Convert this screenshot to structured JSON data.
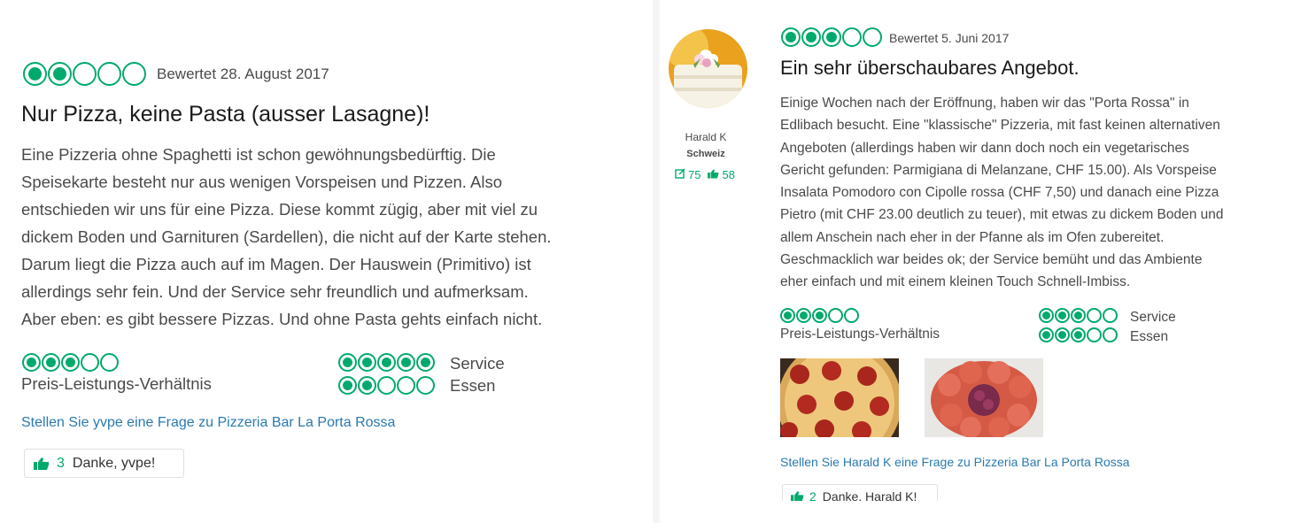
{
  "left_review": {
    "rating": 2,
    "date": "Bewertet 28. August 2017",
    "title": "Nur Pizza, keine Pasta (ausser Lasagne)!",
    "body": [
      "Eine Pizzeria ohne Spaghetti ist schon gewöhnungsbedürftig. Die",
      "Speisekarte besteht nur aus wenigen Vorspeisen und Pizzen. Also",
      "entschieden wir uns für eine Pizza. Diese kommt zügig, aber mit viel zu",
      "dickem Boden und Garnituren (Sardellen), die nicht auf der Karte stehen.",
      "Darum liegt die Pizza auch auf im Magen. Der Hauswein (Primitivo) ist",
      "allerdings sehr fein. Und der Service sehr freundlich und aufmerksam.",
      "Aber eben: es gibt bessere Pizzas. Und ohne Pasta gehts einfach nicht."
    ],
    "subratings": {
      "value_label": "Preis-Leistungs-Verhältnis",
      "value_rating": 3,
      "service_label": "Service",
      "service_rating": 5,
      "food_label": "Essen",
      "food_rating": 2
    },
    "question_link": "Stellen Sie yvpe eine Frage zu Pizzeria Bar La Porta Rossa",
    "thanks_count": "3",
    "thanks_label": "Danke, yvpe!"
  },
  "right_review": {
    "reviewer_name": "Harald K",
    "reviewer_location": "Schweiz",
    "reviews_count": "75",
    "helpful_votes": "58",
    "rating": 3,
    "date": "Bewertet 5. Juni 2017",
    "title": "Ein sehr überschaubares Angebot.",
    "body": [
      "Einige Wochen nach der Eröffnung, haben wir das \"Porta Rossa\" in",
      "Edlibach besucht. Eine \"klassische\" Pizzeria, mit fast keinen alternativen",
      "Angeboten (allerdings haben wir dann doch noch ein vegetarisches",
      "Gericht gefunden: Parmigiana di Melanzane, CHF 15.00). Als Vorspeise",
      "Insalata Pomodoro con Cipolle rossa (CHF 7,50) und danach eine Pizza",
      "Pietro (mit CHF 23.00 deutlich zu teuer), mit etwas zu dickem Boden und",
      "allem Anschein nach eher in der Pfanne als im Ofen zubereitet.",
      "Geschmacklich war beides ok; der Service bemüht und das Ambiente",
      "eher einfach und mit einem kleinen Touch Schnell-Imbiss."
    ],
    "subratings": {
      "value_label": "Preis-Leistungs-Verhältnis",
      "value_rating": 3,
      "service_label": "Service",
      "service_rating": 3,
      "food_label": "Essen",
      "food_rating": 3
    },
    "question_link": "Stellen Sie Harald K eine Frage zu Pizzeria Bar La Porta Rossa",
    "thanks_count": "2",
    "thanks_label": "Danke, Harald K!"
  },
  "colors": {
    "brand": "#00aa6c",
    "link": "#2a7ab0"
  }
}
